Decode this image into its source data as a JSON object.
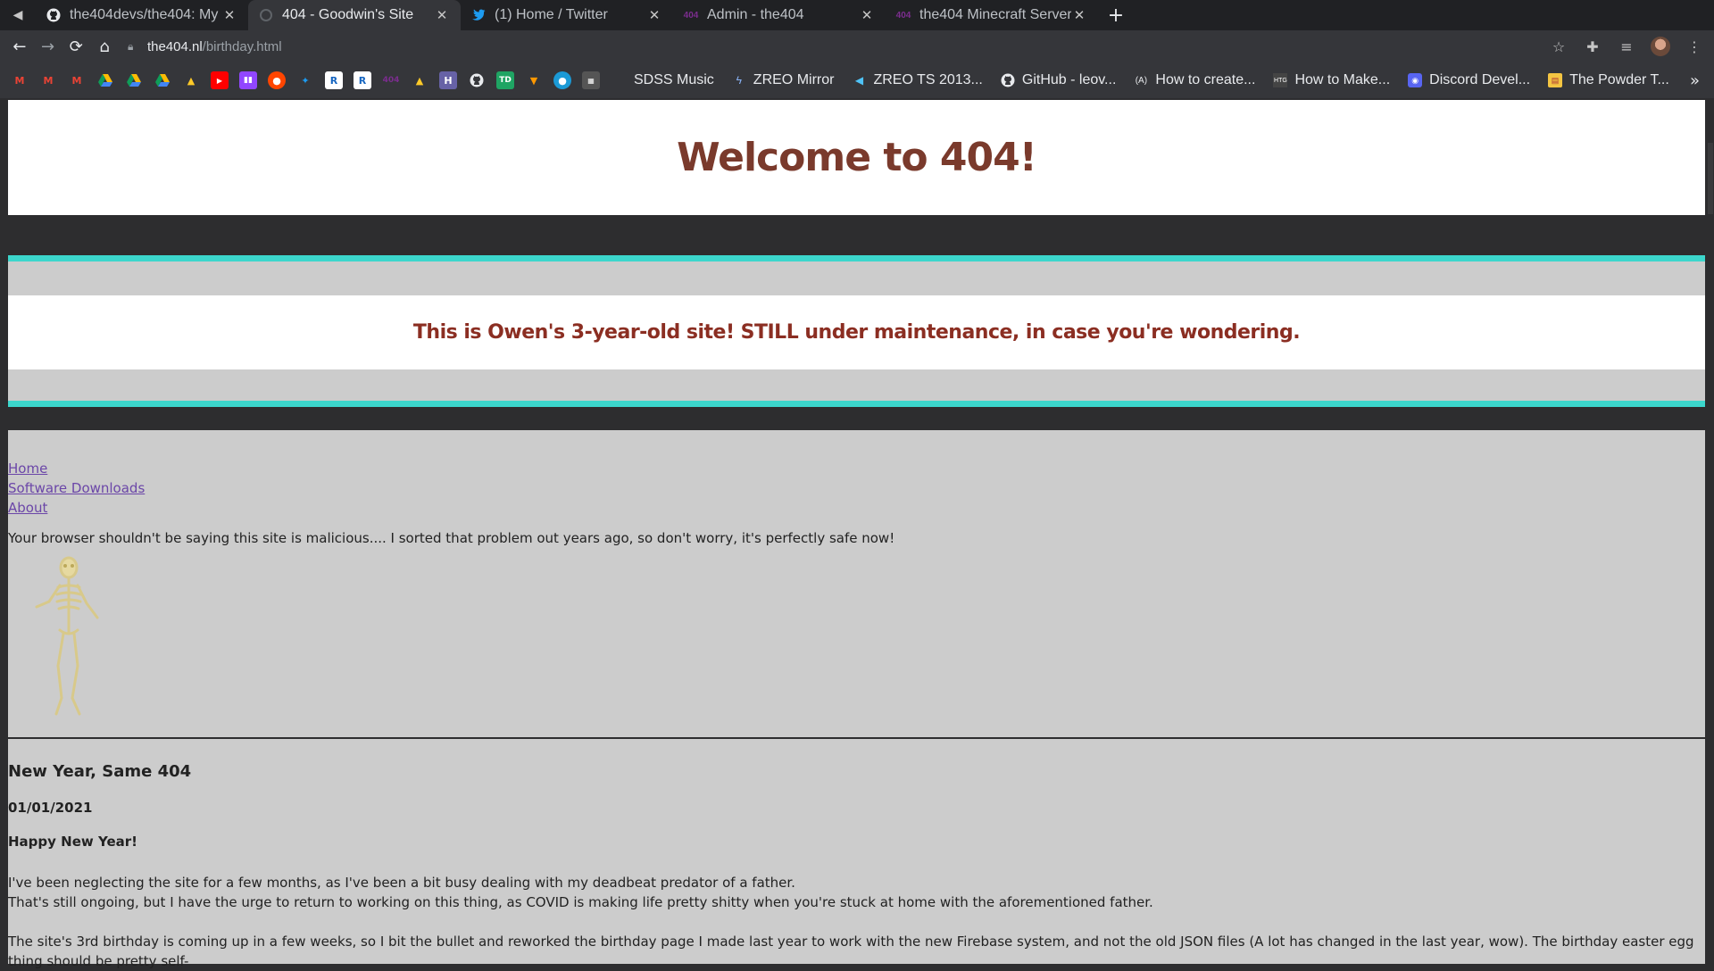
{
  "browser": {
    "tabs": [
      {
        "title": "the404devs/the404: My",
        "icon": "github-icon",
        "active": false
      },
      {
        "title": "404 - Goodwin's Site",
        "icon": "site-icon",
        "active": true
      },
      {
        "title": "(1) Home / Twitter",
        "icon": "twitter-icon",
        "active": false
      },
      {
        "title": "Admin - the404",
        "icon": "the404-icon",
        "active": false
      },
      {
        "title": "the404 Minecraft Server",
        "icon": "the404-icon",
        "active": false
      }
    ],
    "url_host": "the404.nl",
    "url_path": "/birthday.html",
    "bookmarks_named": [
      {
        "label": "SDSS Music",
        "icon": "none"
      },
      {
        "label": "ZREO Mirror",
        "icon": "zreo-icon"
      },
      {
        "label": "ZREO TS 2013...",
        "icon": "zreo-icon"
      },
      {
        "label": "GitHub - leov...",
        "icon": "github-icon"
      },
      {
        "label": "How to create...",
        "icon": "a-icon"
      },
      {
        "label": "How to Make...",
        "icon": "htg-icon"
      },
      {
        "label": "Discord Devel...",
        "icon": "discord-icon"
      },
      {
        "label": "The Powder T...",
        "icon": "powder-icon"
      }
    ]
  },
  "page": {
    "header_title": "Welcome to 404!",
    "notice": "This is Owen's 3-year-old site! STILL under maintenance, in case you're wondering.",
    "nav_links": [
      "Home",
      "Software Downloads",
      "About"
    ],
    "warning": "Your browser shouldn't be saying this site is malicious.... I sorted that problem out years ago, so don't worry, it's perfectly safe now!",
    "post": {
      "title": "New Year, Same 404",
      "date": "01/01/2021",
      "greeting": "Happy New Year!",
      "p1_line1": "I've been neglecting the site for a few months, as I've been a bit busy dealing with my deadbeat predator of a father.",
      "p1_line2": "That's still ongoing, but I have the urge to return to working on this thing, as COVID is making life pretty shitty when you're stuck at home with the aforementioned father.",
      "p2": "The site's 3rd birthday is coming up in a few weeks, so I bit the bullet and reworked the birthday page I made last year to work with the new Firebase system, and not the old JSON files (A lot has changed in the last year, wow). The birthday easter egg thing should be pretty self-"
    }
  },
  "colors": {
    "header_text": "#7a3a2c",
    "notice_text": "#8b2e22",
    "link": "#6b46a8",
    "teal": "#3cd6cc",
    "content_bg": "#cccccc",
    "page_bg": "#2d2d2f"
  }
}
